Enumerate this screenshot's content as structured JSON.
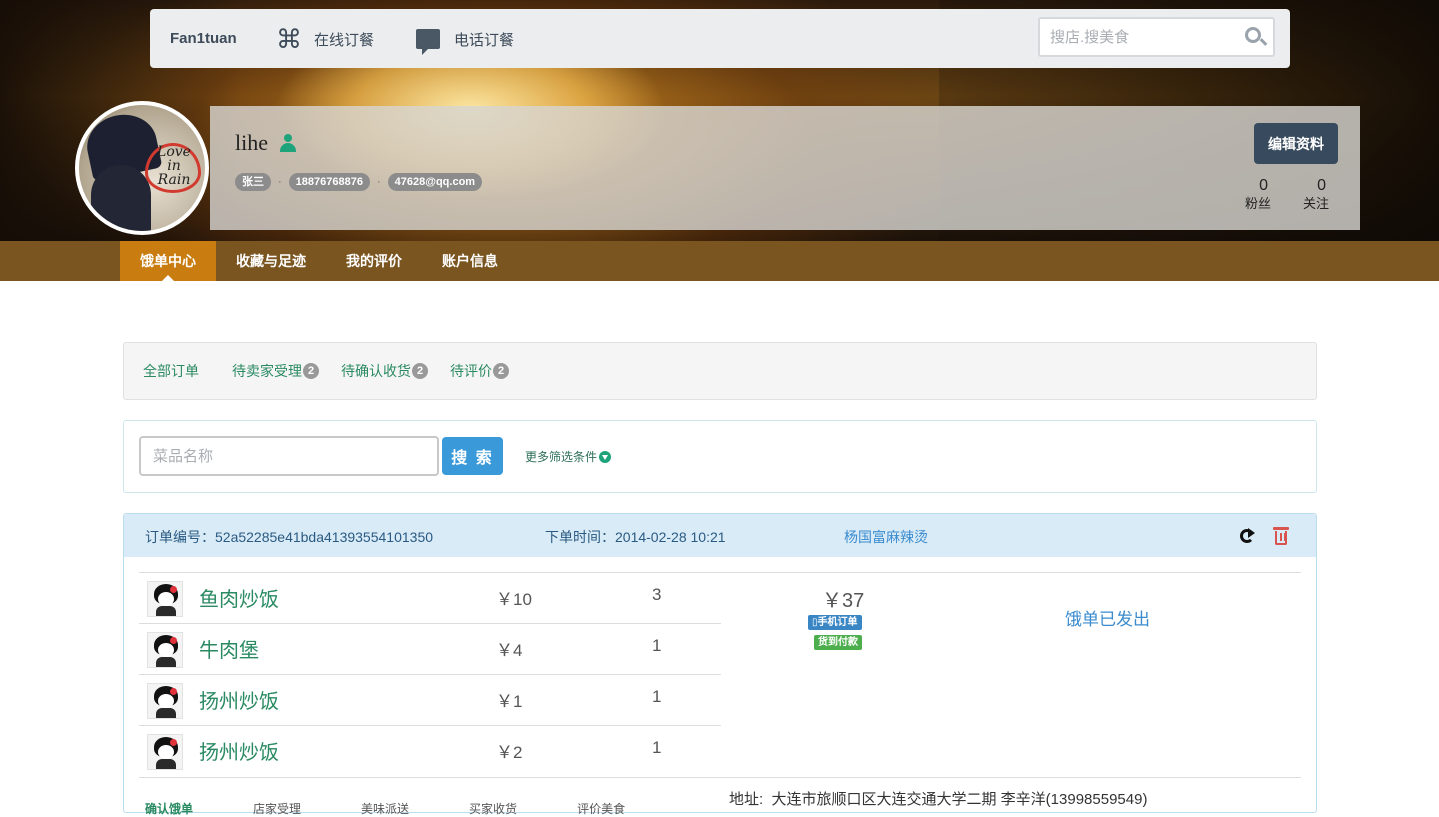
{
  "topnav": {
    "brand": "Fan1tuan",
    "online_order": "在线订餐",
    "phone_order": "电话订餐",
    "search_placeholder": "搜店.搜美食"
  },
  "profile": {
    "username": "lihe",
    "real_name": "张三",
    "phone": "18876768876",
    "email": "47628@qq.com",
    "edit_label": "编辑资料",
    "fans_count": "0",
    "fans_label": "粉丝",
    "follow_count": "0",
    "follow_label": "关注",
    "avatar_text": "Love in Rain"
  },
  "subnav": {
    "items": [
      "饿单中心",
      "收藏与足迹",
      "我的评价",
      "账户信息"
    ],
    "active": "饿单中心"
  },
  "filter_tabs": [
    {
      "label": "全部订单",
      "count": ""
    },
    {
      "label": "待卖家受理",
      "count": "2"
    },
    {
      "label": "待确认收货",
      "count": "2"
    },
    {
      "label": "待评价",
      "count": "2"
    }
  ],
  "search": {
    "placeholder": "菜品名称",
    "button": "搜 索",
    "more_filters": "更多筛选条件"
  },
  "order": {
    "number_label": "订单编号：",
    "number": "52a52285e41bda41393554101350",
    "time_label": "下单时间：",
    "time": "2014-02-28 10:21",
    "shop": "杨国富麻辣烫",
    "items": [
      {
        "name": "鱼肉炒饭",
        "price": "￥10",
        "qty": "3"
      },
      {
        "name": "牛肉堡",
        "price": "￥4",
        "qty": "1"
      },
      {
        "name": "扬州炒饭",
        "price": "￥1",
        "qty": "1"
      },
      {
        "name": "扬州炒饭",
        "price": "￥2",
        "qty": "1"
      }
    ],
    "total": "￥37",
    "tag_mobile": "手机订单",
    "tag_cod": "货到付款",
    "status": "饿单已发出",
    "progress": [
      "确认饿单",
      "店家受理",
      "美味派送",
      "买家收货",
      "评价美食"
    ],
    "address_label": "地址:",
    "address": "大连市旅顺口区大连交通大学二期 李辛洋(13998559549)"
  },
  "colors": {
    "accent_green": "#2a8a62",
    "subnav_bg": "#7a5520",
    "subnav_active": "#c97c10",
    "primary_blue": "#3a99d8",
    "edit_btn": "#384a5e"
  }
}
